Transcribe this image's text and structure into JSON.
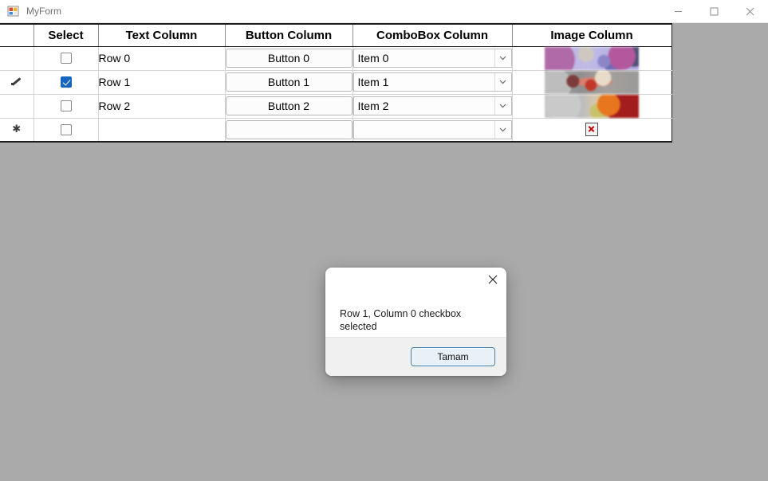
{
  "window": {
    "title": "MyForm",
    "icon": "form-icon",
    "controls": {
      "minimize": "minimize-icon",
      "maximize": "maximize-icon",
      "close": "close-icon"
    }
  },
  "grid": {
    "columns": [
      {
        "key": "rowheader",
        "label": ""
      },
      {
        "key": "select",
        "label": "Select"
      },
      {
        "key": "text",
        "label": "Text Column"
      },
      {
        "key": "button",
        "label": "Button Column"
      },
      {
        "key": "combobox",
        "label": "ComboBox Column"
      },
      {
        "key": "image",
        "label": "Image Column"
      }
    ],
    "rows": [
      {
        "row_header": "",
        "selected": false,
        "checked": false,
        "text": "Row 0",
        "button": "Button 0",
        "combo": "Item 0",
        "image": "thumbnail-purple",
        "image_broken": false
      },
      {
        "row_header": "edit-pencil-icon",
        "selected": true,
        "checked": true,
        "text": "Row 1",
        "button": "Button 1",
        "combo": "Item 1",
        "image": "thumbnail-gray-red",
        "image_broken": false
      },
      {
        "row_header": "",
        "selected": false,
        "checked": false,
        "text": "Row 2",
        "button": "Button 2",
        "combo": "Item 2",
        "image": "thumbnail-orange-red",
        "image_broken": false
      },
      {
        "row_header": "new-row-asterisk-icon",
        "selected": false,
        "checked": false,
        "text": "",
        "button": "",
        "combo": "",
        "image": "broken-image-icon",
        "image_broken": true
      }
    ],
    "combo_arrow_icon": "chevron-down-icon",
    "selection_color": "#0a74cc",
    "checkbox_checked_color": "#1565c0"
  },
  "dialog": {
    "message": "Row 1, Column 0 checkbox selected",
    "ok_label": "Tamam",
    "close_icon": "close-icon"
  },
  "theme": {
    "form_background": "#aaaaaa",
    "titlebar_background": "#ffffff",
    "grid_background": "#ffffff"
  }
}
